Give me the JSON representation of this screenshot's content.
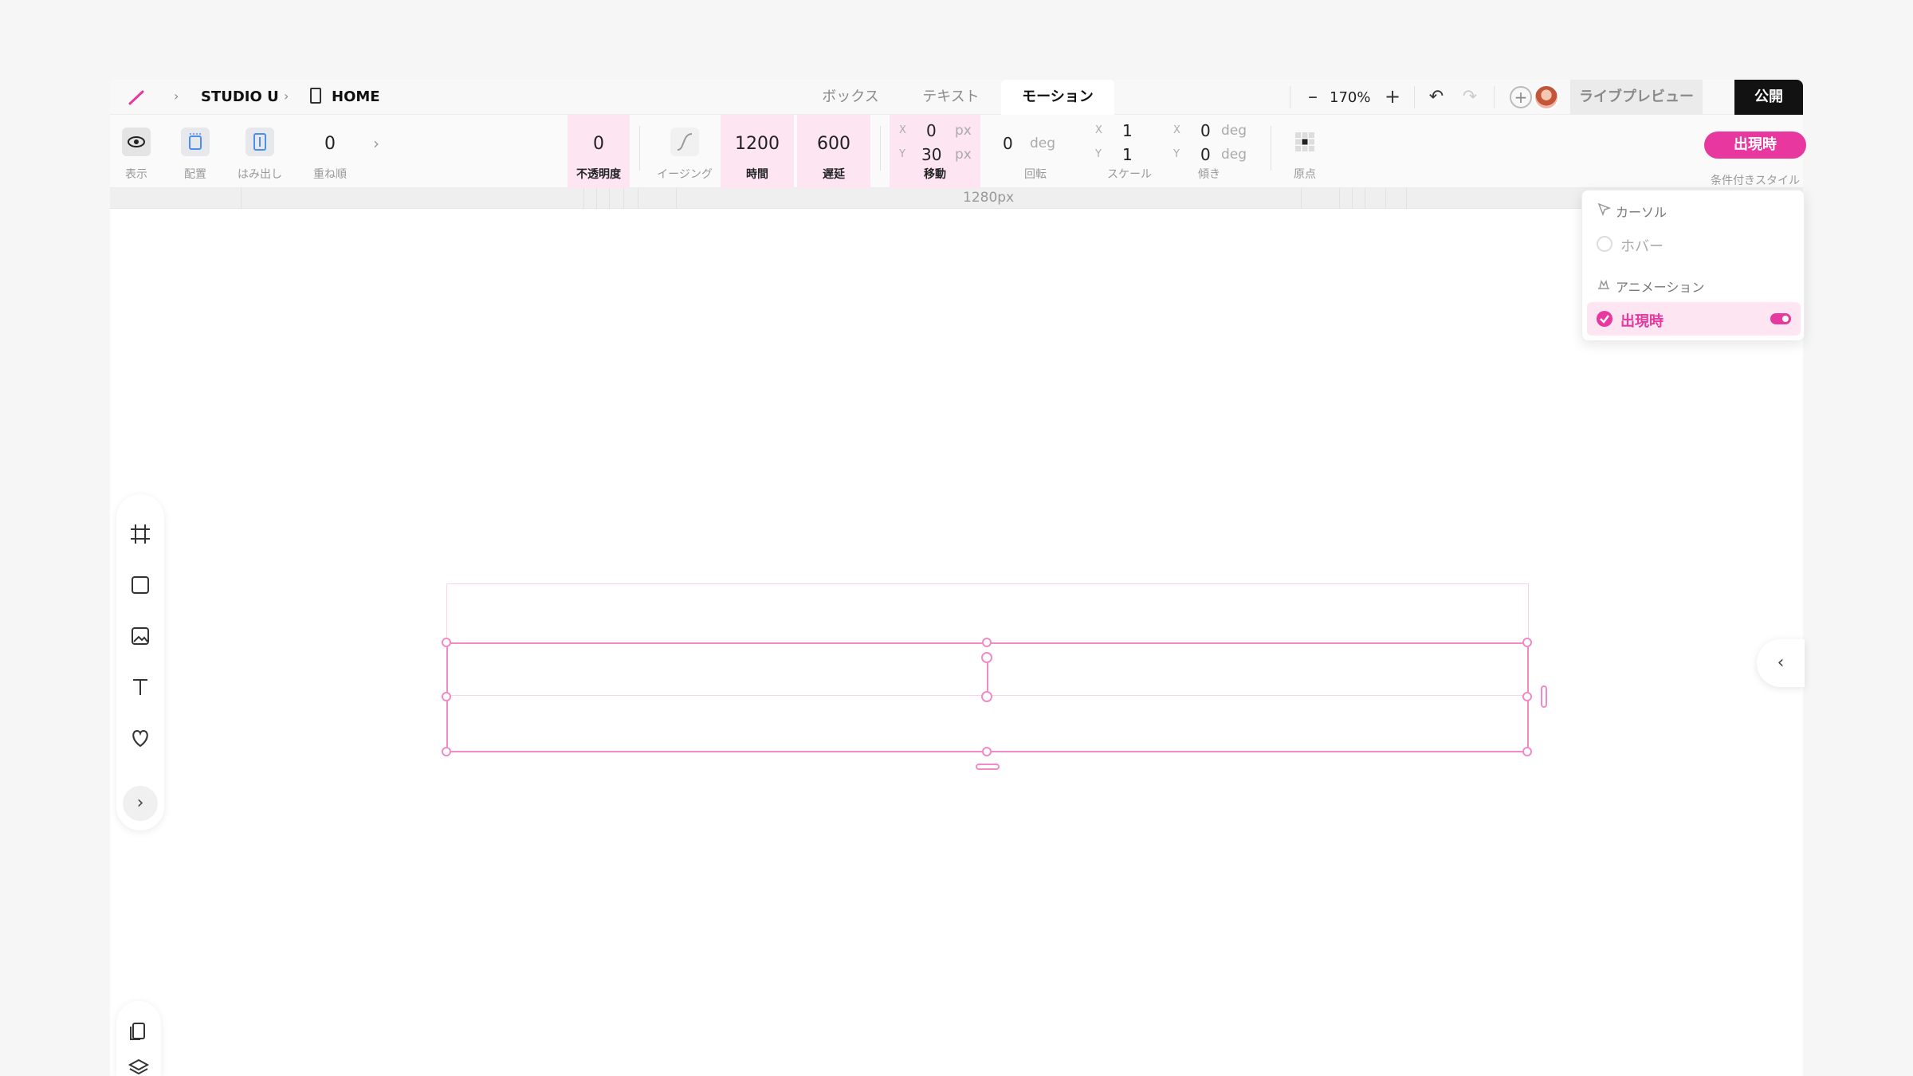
{
  "breadcrumb": {
    "project": "STUDIO U",
    "page": "HOME"
  },
  "tabs": [
    {
      "label": "ボックス",
      "active": false
    },
    {
      "label": "テキスト",
      "active": false
    },
    {
      "label": "モーション",
      "active": true
    }
  ],
  "zoom": {
    "value": "170%",
    "minus": "–",
    "plus": "+"
  },
  "header": {
    "live_preview": "ライブプレビュー",
    "publish": "公開"
  },
  "toolbar": {
    "display": "表示",
    "layout": "配置",
    "overflow": "はみ出し",
    "zorder": {
      "value": "0",
      "label": "重ね順"
    },
    "opacity": {
      "value": "0",
      "label": "不透明度"
    },
    "easing": "イージング",
    "duration": {
      "value": "1200",
      "label": "時間"
    },
    "delay": {
      "value": "600",
      "label": "遅延"
    },
    "move": {
      "x": "0",
      "y": "30",
      "unit": "px",
      "label": "移動"
    },
    "rotate": {
      "value": "0",
      "unit": "deg",
      "label": "回転"
    },
    "scale": {
      "x": "1",
      "y": "1",
      "label": "スケール"
    },
    "skew": {
      "x": "0",
      "y": "0",
      "unit": "deg",
      "label": "傾き"
    },
    "origin": "原点",
    "axis_x": "X",
    "axis_y": "Y",
    "condition_button": "出現時",
    "condition_label": "条件付きスタイル"
  },
  "ruler": {
    "width_label": "1280px"
  },
  "dropdown": {
    "cursor_heading": "カーソル",
    "hover": "ホバー",
    "animation_heading": "アニメーション",
    "appear": "出現時"
  },
  "colors": {
    "accent": "#e8389f",
    "accent_light": "#fde6f2",
    "selection": "#f18ac6"
  }
}
